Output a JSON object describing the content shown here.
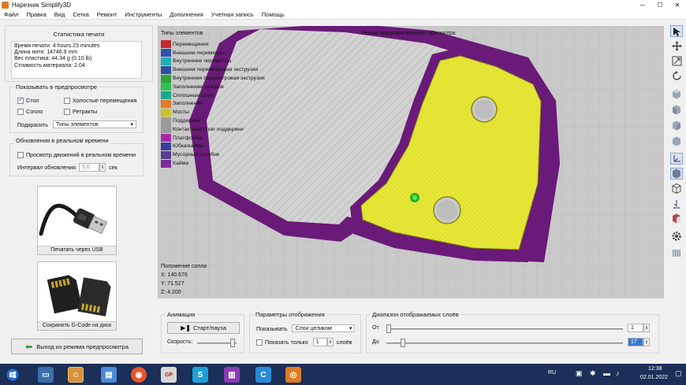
{
  "window": {
    "title": "Нарезчик Simplify3D",
    "minimize": "─",
    "maximize": "☐",
    "close": "✕"
  },
  "menu": [
    "Файл",
    "Правка",
    "Вид",
    "Сетка",
    "Ремонт",
    "Инструменты",
    "Дополнения",
    "Учетная запись",
    "Помощь"
  ],
  "stats": {
    "title": "Статистика печати",
    "lines": [
      "Время печати: 4 hours 23 minutes",
      "Длина нити: 14746.9 mm",
      "Вес пластика: 44.34 g (0.10 lb)",
      "Стоимость материала: 2.04"
    ]
  },
  "preview": {
    "title": "Показывать в предпросмотре",
    "bed": "Стол",
    "bed_checked": true,
    "travel": "Холостые перемещения",
    "travel_checked": false,
    "nozzle": "Сопло",
    "nozzle_checked": false,
    "retracts": "Ретракты",
    "retracts_checked": false,
    "color_label": "Подкрасить",
    "color_value": "Типы элементов"
  },
  "realtime": {
    "title": "Обновления в реальном времени",
    "view_label": "Просмотр движений в реальном времени",
    "interval_label": "Интервал обновления",
    "interval_value": "5,0",
    "interval_unit": "сек"
  },
  "usb_caption": "Печатать через USB",
  "sd_caption": "Сохранить G-Code на диск",
  "exit_label": "Выход из режима предпросмотра",
  "viewport": {
    "legend_title": "Типы элементов",
    "mode_title": "Режим предварительного просмотра",
    "legend": [
      {
        "label": "Перемещения",
        "color": "#c8262f"
      },
      {
        "label": "Внешние периметры",
        "color": "#2d54b0"
      },
      {
        "label": "Внутренние периметры",
        "color": "#22aab4"
      },
      {
        "label": "Внешняя периметровая экструзия",
        "color": "#2a4fa0"
      },
      {
        "label": "Внутренняя периметровая экструзия",
        "color": "#2fa33b"
      },
      {
        "label": "Заполнение зазоров",
        "color": "#33c058"
      },
      {
        "label": "Сплошные слои",
        "color": "#1ba88e"
      },
      {
        "label": "Заполнение",
        "color": "#e37a27"
      },
      {
        "label": "Мосты",
        "color": "#c9c327"
      },
      {
        "label": "Поддержки",
        "color": "#9a9a9a"
      },
      {
        "label": "Контактные слои поддержки",
        "color": "#9a9a9a"
      },
      {
        "label": "Платформа",
        "color": "#a62aa4"
      },
      {
        "label": "Юбка/кайма",
        "color": "#3a3f9e"
      },
      {
        "label": "Мусорный столбик",
        "color": "#5a3b8e"
      },
      {
        "label": "Кайма",
        "color": "#7b2d9b"
      }
    ],
    "nozzle_title": "Положение сопла",
    "x": "X: 140.676",
    "y": "Y: 71.527",
    "z": "Z: 4.200"
  },
  "animation": {
    "title": "Анимация",
    "play_label": "Старт/пауза",
    "speed_label": "Скорость:",
    "speed_fraction": 0.95
  },
  "display": {
    "title": "Параметры отображения",
    "show_label": "Показывать",
    "show_value": "Слои целиком",
    "only_label": "Показать только",
    "only_value": "1",
    "only_unit": "слоёв"
  },
  "range": {
    "title": "Диапазон отображаемых слоёв",
    "from_label": "От",
    "from_value": "1",
    "from_fraction": 0.0,
    "to_label": "До",
    "to_value": "17",
    "to_fraction": 0.06
  },
  "taskbar": {
    "lang": "RU",
    "time": "12:38",
    "date": "02.01.2022"
  },
  "colors": {
    "purple": "#6a1a78",
    "yellow": "#e6e635",
    "gray_part": "#d2d2d2",
    "viewport_bg": "#c9c9c9",
    "taskbar": "#1b2f58"
  }
}
